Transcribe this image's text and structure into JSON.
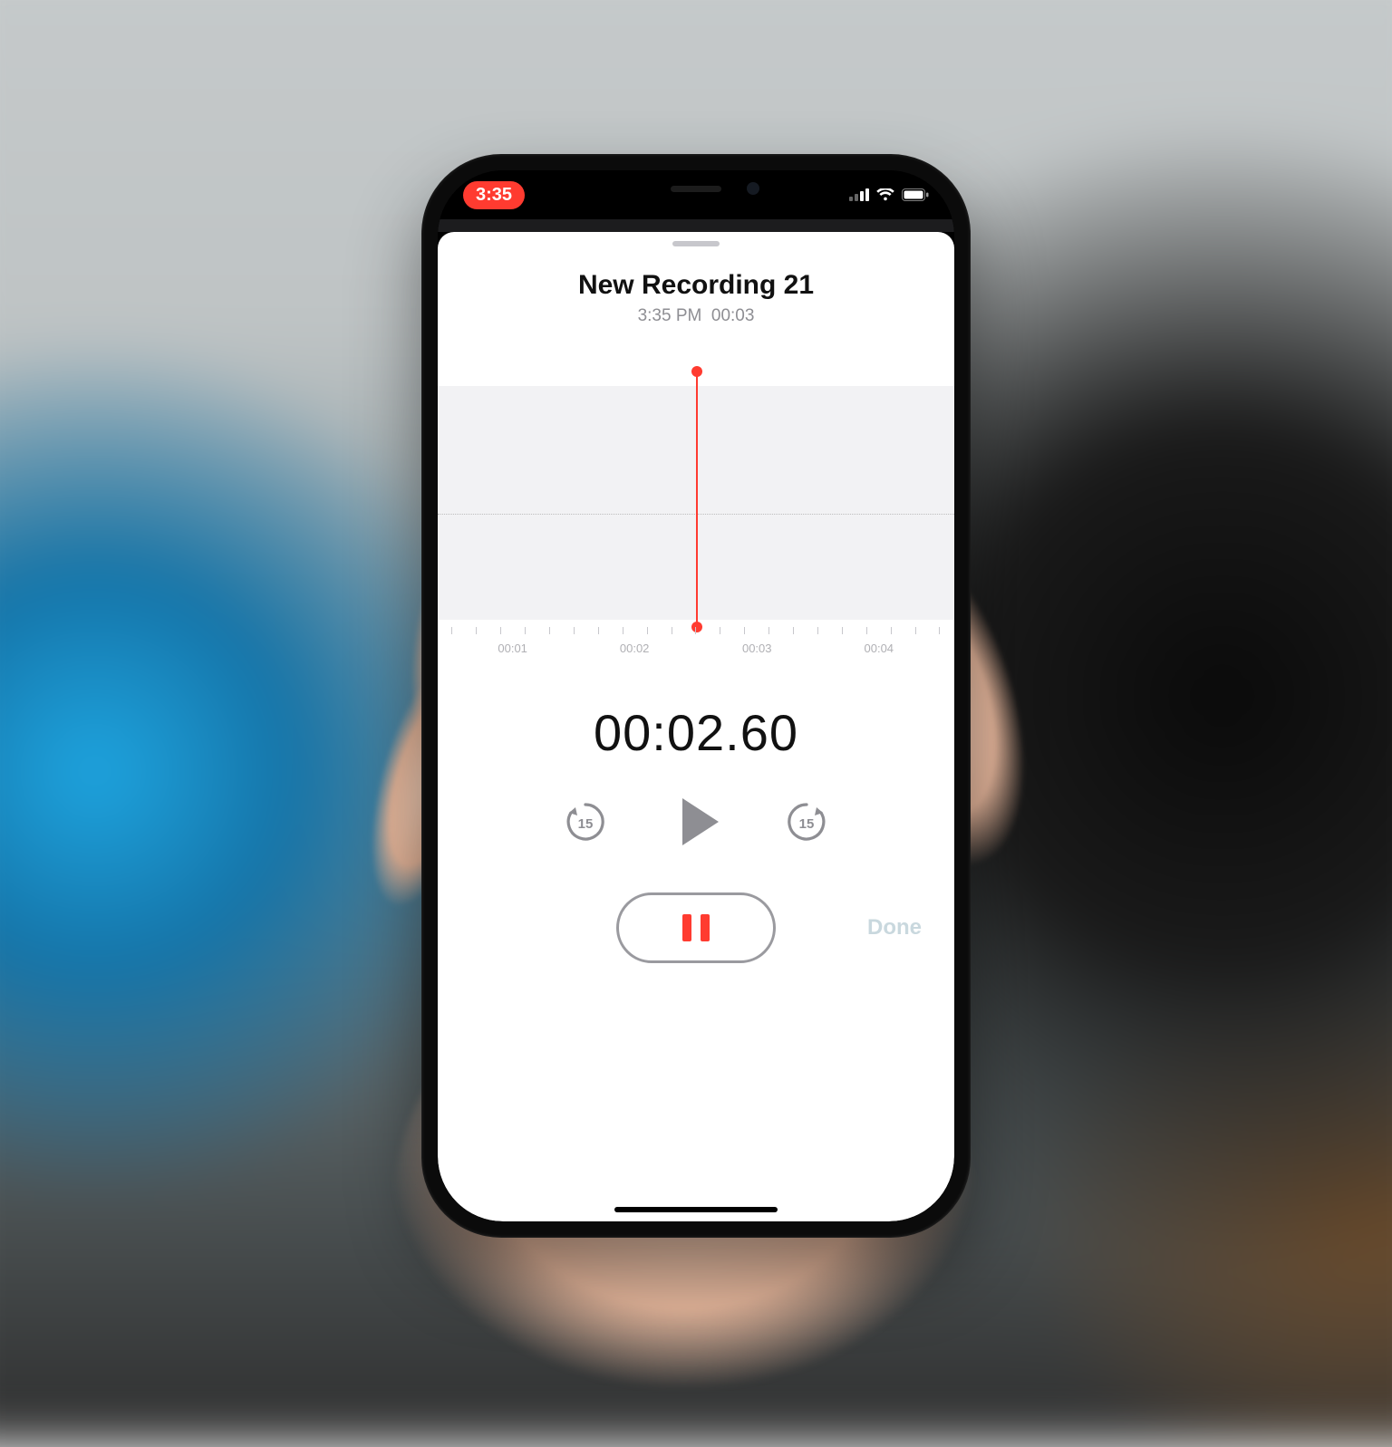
{
  "status": {
    "time_pill": "3:35"
  },
  "recording": {
    "title": "New Recording 21",
    "subtitle_time": "3:35 PM",
    "subtitle_duration": "00:03"
  },
  "timeline": {
    "ticks": [
      "00:01",
      "00:02",
      "00:03",
      "00:04"
    ]
  },
  "timer": "00:02.60",
  "transport": {
    "skip_amount": "15"
  },
  "buttons": {
    "done": "Done"
  },
  "colors": {
    "accent": "#ff3b30"
  }
}
